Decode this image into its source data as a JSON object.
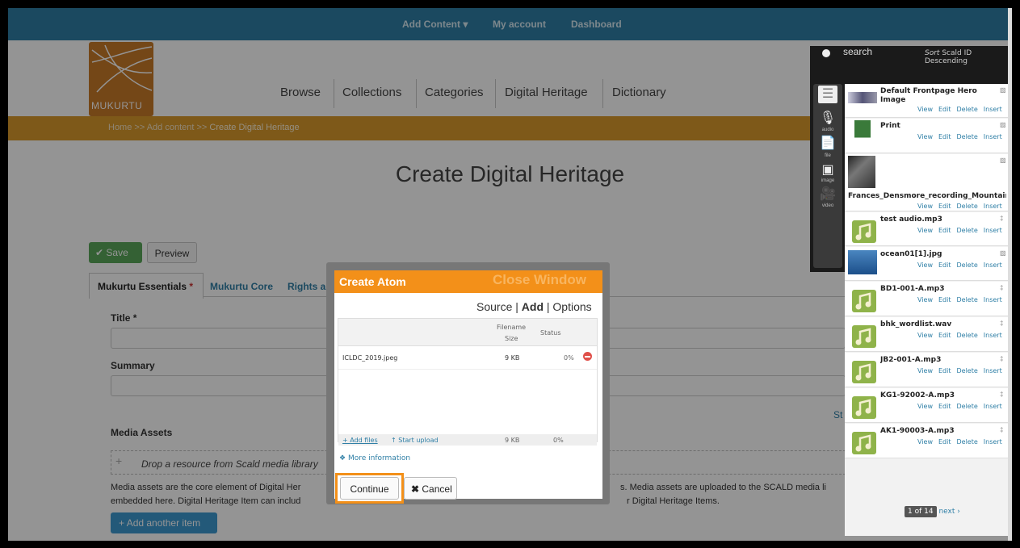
{
  "topbar": {
    "links": [
      "Add Content ▾",
      "My account",
      "Dashboard"
    ]
  },
  "logo": {
    "text": "MUKURTU"
  },
  "nav": {
    "items": [
      "Browse",
      "Collections",
      "Categories",
      "Digital Heritage",
      "Dictionary"
    ]
  },
  "breadcrumb": {
    "home": "Home",
    "sep": " >> ",
    "add": "Add content",
    "current": "Create Digital Heritage"
  },
  "page": {
    "title": "Create Digital Heritage"
  },
  "toolbar": {
    "save": "Save",
    "preview": "Preview"
  },
  "tabs": [
    "Mukurtu Essentials",
    "Mukurtu Core",
    "Rights a"
  ],
  "form": {
    "title_label": "Title *",
    "summary_label": "Summary",
    "media_label": "Media Assets",
    "drop_text": "Drop a resource from Scald media library",
    "help1_left": "Media assets are the core element of Digital Her",
    "help1_right": "s. Media assets are uploaded to the SCALD media li",
    "help2_left": "embedded here. Digital Heritage Item can includ",
    "help2_right": "r Digital Heritage Items.",
    "add_another": "Add another item",
    "st_link": "St"
  },
  "modal": {
    "title": "Create Atom",
    "close": "Close Window",
    "nav_source": "Source",
    "nav_sep": " | ",
    "nav_add": "Add",
    "nav_options": "Options",
    "col_filename": "Filename",
    "col_size": "Size",
    "col_status": "Status",
    "file_name": "ICLDC_2019.jpeg",
    "file_size": "9 KB",
    "file_status": "0%",
    "add_files": "Add files",
    "start_upload": "Start upload",
    "total_size": "9 KB",
    "total_status": "0%",
    "more_info": "More information",
    "continue": "Continue",
    "cancel": "Cancel"
  },
  "scald": {
    "search": "search",
    "sort_label": "Sort",
    "sort_value": "Scald ID Descending",
    "types": [
      "audio",
      "file",
      "image",
      "video"
    ],
    "actions": [
      "View",
      "Edit",
      "Delete",
      "Insert"
    ],
    "items": [
      {
        "title": "Default Frontpage Hero",
        "title2": "Image",
        "kind": "image"
      },
      {
        "title": "Print",
        "title2": "",
        "kind": "image"
      },
      {
        "title": "Frances_Densmore_recording_Mountain",
        "title2": "",
        "kind": "image"
      },
      {
        "title": "test audio.mp3",
        "title2": "",
        "kind": "audio"
      },
      {
        "title": "ocean01[1].jpg",
        "title2": "",
        "kind": "image"
      },
      {
        "title": "BD1-001-A.mp3",
        "title2": "",
        "kind": "audio"
      },
      {
        "title": "bhk_wordlist.wav",
        "title2": "",
        "kind": "audio"
      },
      {
        "title": "JB2-001-A.mp3",
        "title2": "",
        "kind": "audio"
      },
      {
        "title": "KG1-92002-A.mp3",
        "title2": "",
        "kind": "audio"
      },
      {
        "title": "AK1-90003-A.mp3",
        "title2": "",
        "kind": "audio"
      }
    ],
    "pager": "1 of 14",
    "next": "next ›"
  },
  "colors": {
    "topbar": "#2f7fa6",
    "brand": "#c97a28",
    "crumb": "#d99a2b",
    "modal_accent": "#f39019",
    "save": "#5aa75a"
  }
}
